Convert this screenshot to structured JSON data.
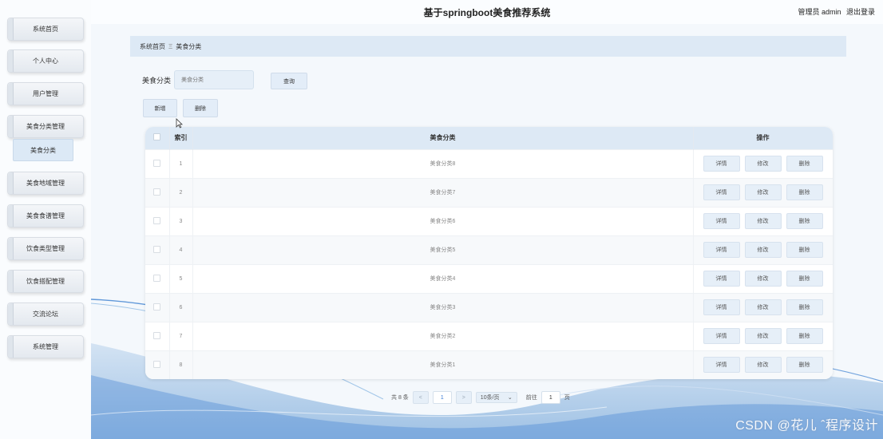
{
  "header": {
    "title": "基于springboot美食推荐系统",
    "user": "管理员 admin",
    "logout": "退出登录"
  },
  "sidebar": {
    "items": [
      {
        "label": "系统首页"
      },
      {
        "label": "个人中心"
      },
      {
        "label": "用户管理"
      },
      {
        "label": "美食分类管理"
      },
      {
        "label": "美食地域管理"
      },
      {
        "label": "美食食谱管理"
      },
      {
        "label": "饮食类型管理"
      },
      {
        "label": "饮食搭配管理"
      },
      {
        "label": "交流论坛"
      },
      {
        "label": "系统管理"
      }
    ],
    "submenu_label": "美食分类"
  },
  "breadcrumb": {
    "home": "系统首页",
    "separator": "Ξ",
    "current": "美食分类"
  },
  "search": {
    "label": "美食分类",
    "placeholder": "美食分类",
    "query_button": "查询"
  },
  "toolbar": {
    "add_label": "新增",
    "delete_label": "删除"
  },
  "table": {
    "headers": {
      "index": "索引",
      "category": "美食分类",
      "actions": "操作"
    },
    "rows": [
      {
        "index": "1",
        "category": "美食分类8"
      },
      {
        "index": "2",
        "category": "美食分类7"
      },
      {
        "index": "3",
        "category": "美食分类6"
      },
      {
        "index": "4",
        "category": "美食分类5"
      },
      {
        "index": "5",
        "category": "美食分类4"
      },
      {
        "index": "6",
        "category": "美食分类3"
      },
      {
        "index": "7",
        "category": "美食分类2"
      },
      {
        "index": "8",
        "category": "美食分类1"
      }
    ],
    "row_actions": {
      "detail": "详情",
      "edit": "修改",
      "delete": "删除"
    }
  },
  "pagination": {
    "total": "共 8 条",
    "prev": "<",
    "current_page": "1",
    "next": ">",
    "page_size": "10条/页",
    "page_size_arrow": "⌄",
    "goto_label": "前往",
    "goto_value": "1",
    "page_unit": "页"
  },
  "watermark": "CSDN @花儿 ˆ程序设计",
  "colors": {
    "accent": "#dde9f5",
    "button": "#e6eff8",
    "wave": "#3b7fd0"
  }
}
